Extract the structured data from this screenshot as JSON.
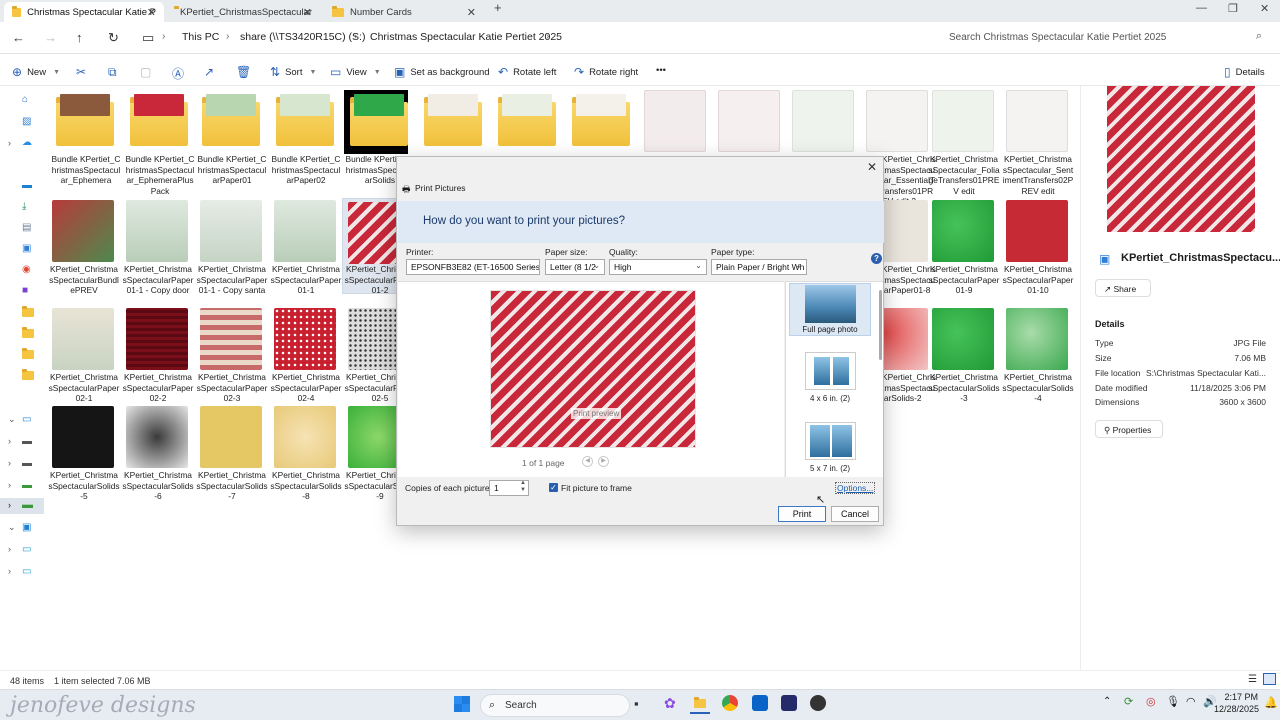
{
  "tabs": [
    {
      "label": "Christmas Spectacular Katie P"
    },
    {
      "label": "KPertiet_ChristmasSpectacular"
    },
    {
      "label": "Number Cards"
    }
  ],
  "breadcrumb": [
    "This PC",
    "share (\\\\TS3420R15C) (S:)",
    "Christmas Spectacular Katie Pertiet 2025"
  ],
  "search_placeholder": "Search Christmas Spectacular Katie Pertiet 2025",
  "toolbar": {
    "new": "New",
    "sort": "Sort",
    "view": "View",
    "set_bg": "Set as background",
    "rotate_left": "Rotate left",
    "rotate_right": "Rotate right",
    "more": "•••",
    "details": "Details"
  },
  "files": [
    {
      "name": "Bundle KPertiet_ChristmasSpectacular_Ephemera"
    },
    {
      "name": "Bundle KPertiet_ChristmasSpectacular_EphemeraPlusPack"
    },
    {
      "name": "Bundle KPertiet_ChristmasSpectacularPaper01"
    },
    {
      "name": "Bundle KPertiet_ChristmasSpectacularPaper02"
    },
    {
      "name": "Bundle KPertiet_ChristmasSpectacularSolids"
    },
    {
      "name": "KPertiet_ChristmasSpectacular_EssentialTransfers01PREV edit 2"
    },
    {
      "name": "KPertiet_ChristmasSpectacular_FoliageTransfers01PREV edit"
    },
    {
      "name": "KPertiet_ChristmasSpectacular_SentimentTransfers02PREV edit"
    },
    {
      "name": "KPertiet_ChristmasSpectacularBundlePREV"
    },
    {
      "name": "KPertiet_ChristmasSpectacularPaper01-1 - Copy door"
    },
    {
      "name": "KPertiet_ChristmasSpectacularPaper01-1 - Copy santa"
    },
    {
      "name": "KPertiet_ChristmasSpectacularPaper01-1"
    },
    {
      "name": "KPertiet_ChristmasSpectacularPaper01-2"
    },
    {
      "name": "KPertiet_ChristmasSpectacularPaper01-8"
    },
    {
      "name": "KPertiet_ChristmasSpectacularPaper01-9"
    },
    {
      "name": "KPertiet_ChristmasSpectacularPaper01-10"
    },
    {
      "name": "KPertiet_ChristmasSpectacularPaper02-1"
    },
    {
      "name": "KPertiet_ChristmasSpectacularPaper02-2"
    },
    {
      "name": "KPertiet_ChristmasSpectacularPaper02-3"
    },
    {
      "name": "KPertiet_ChristmasSpectacularPaper02-4"
    },
    {
      "name": "KPertiet_ChristmasSpectacularPaper02-5"
    },
    {
      "name": "KPertiet_ChristmasSpectacularSolids-2"
    },
    {
      "name": "KPertiet_ChristmasSpectacularSolids-3"
    },
    {
      "name": "KPertiet_ChristmasSpectacularSolids-4"
    },
    {
      "name": "KPertiet_ChristmasSpectacularSolids-5"
    },
    {
      "name": "KPertiet_ChristmasSpectacularSolids-6"
    },
    {
      "name": "KPertiet_ChristmasSpectacularSolids-7"
    },
    {
      "name": "KPertiet_ChristmasSpectacularSolids-8"
    },
    {
      "name": "KPertiet_ChristmasSpectacularSolids-9"
    }
  ],
  "details": {
    "filename": "KPertiet_ChristmasSpectacu...",
    "share": "Share",
    "heading": "Details",
    "rows": [
      {
        "k": "Type",
        "v": "JPG File"
      },
      {
        "k": "Size",
        "v": "7.06 MB"
      },
      {
        "k": "File location",
        "v": "S:\\Christmas Spectacular Kati..."
      },
      {
        "k": "Date modified",
        "v": "11/18/2025 3:06 PM"
      },
      {
        "k": "Dimensions",
        "v": "3600 x 3600"
      }
    ],
    "properties": "Properties"
  },
  "status": {
    "count": "48 items",
    "selected": "1 item selected  7.06 MB"
  },
  "dialog": {
    "title": "Print Pictures",
    "question": "How do you want to print your pictures?",
    "printer_label": "Printer:",
    "printer_value": "EPSONFB3E82 (ET-16500 Series)",
    "paper_size_label": "Paper size:",
    "paper_size_value": "Letter (8 1/2",
    "quality_label": "Quality:",
    "quality_value": "High",
    "paper_type_label": "Paper type:",
    "paper_type_value": "Plain Paper / Bright Wh",
    "preview_label": "Print preview",
    "pager": "1 of 1 page",
    "layouts": [
      {
        "label": "Full page photo"
      },
      {
        "label": "4 x 6 in. (2)"
      },
      {
        "label": "5 x 7 in. (2)"
      }
    ],
    "copies_label": "Copies of each picture:",
    "copies_value": "1",
    "fit_label": "Fit picture to frame",
    "fit_checked": true,
    "options": "Options...",
    "print": "Print",
    "cancel": "Cancel"
  },
  "taskbar": {
    "search": "Search",
    "time": "2:17 PM",
    "date": "12/28/2025"
  },
  "watermark": "jenofeve designs"
}
